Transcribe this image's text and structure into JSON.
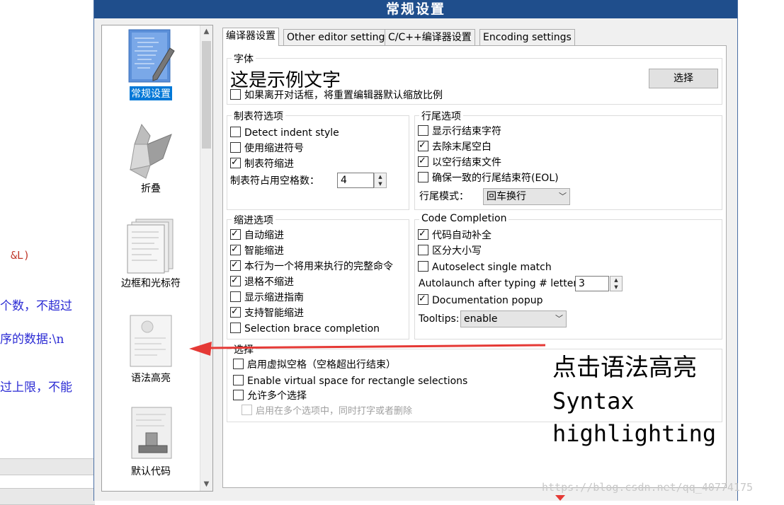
{
  "background": {
    "line1": "&L)",
    "line2": "个数，不超过",
    "line3": "序的数据:\\n",
    "line4": "过上限，不能"
  },
  "dialog": {
    "title": "常规设置"
  },
  "categories": [
    {
      "label": "常规设置",
      "icon": "editor-page-pencil-icon",
      "selected": true
    },
    {
      "label": "折叠",
      "icon": "origami-bird-icon",
      "selected": false
    },
    {
      "label": "边框和光标符",
      "icon": "document-stack-icon",
      "selected": false
    },
    {
      "label": "语法高亮",
      "icon": "highlight-page-icon",
      "selected": false
    },
    {
      "label": "默认代码",
      "icon": "stamp-page-icon",
      "selected": false
    }
  ],
  "tabs": [
    "编译器设置",
    "Other editor settings",
    "C/C++编译器设置",
    "Encoding settings"
  ],
  "font_group": {
    "title": "字体",
    "sample": "这是示例文字",
    "choose_button": "选择",
    "reset_zoom": {
      "label": "如果离开对话框，将重置编辑器默认缩放比例",
      "checked": false
    }
  },
  "tab_group": {
    "title": "制表符选项",
    "items": [
      {
        "label": "Detect indent style",
        "checked": false
      },
      {
        "label": "使用缩进符号",
        "checked": false
      },
      {
        "label": "制表符缩进",
        "checked": true
      }
    ],
    "spaces_label": "制表符占用空格数：",
    "spaces_value": "4"
  },
  "eol_group": {
    "title": "行尾选项",
    "items": [
      {
        "label": "显示行结束字符",
        "checked": false
      },
      {
        "label": "去除末尾空白",
        "checked": true
      },
      {
        "label": "以空行结束文件",
        "checked": true
      },
      {
        "label": "确保一致的行尾结束符(EOL)",
        "checked": false
      }
    ],
    "mode_label": "行尾模式：",
    "mode_value": "回车换行"
  },
  "indent_group": {
    "title": "缩进选项",
    "items": [
      {
        "label": "自动缩进",
        "checked": true
      },
      {
        "label": "智能缩进",
        "checked": true
      },
      {
        "label": "本行为一个将用来执行的完整命令",
        "checked": true
      },
      {
        "label": "退格不缩进",
        "checked": true
      },
      {
        "label": "显示缩进指南",
        "checked": false
      },
      {
        "label": "支持智能缩进",
        "checked": true
      },
      {
        "label": "Selection brace completion",
        "checked": false
      }
    ]
  },
  "completion_group": {
    "title": "Code Completion",
    "items": [
      {
        "label": "代码自动补全",
        "checked": true
      },
      {
        "label": "区分大小写",
        "checked": false
      },
      {
        "label": "Autoselect single match",
        "checked": false
      }
    ],
    "autolaunch_label": "Autolaunch after typing # letters:",
    "autolaunch_value": "3",
    "doc_popup": {
      "label": "Documentation popup",
      "checked": true
    },
    "tooltips_label": "Tooltips:",
    "tooltips_value": "enable"
  },
  "selection_group": {
    "title": "选择",
    "items": [
      {
        "label": "启用虚拟空格（空格超出行结束）",
        "checked": false
      },
      {
        "label": "Enable virtual space for rectangle selections",
        "checked": false
      },
      {
        "label": "允许多个选择",
        "checked": false
      },
      {
        "label": "启用在多个选项中，同时打字或者删除",
        "checked": false,
        "disabled": true
      }
    ]
  },
  "annotation": {
    "line1": "点击语法高亮",
    "line2": "Syntax",
    "line3": "highlighting",
    "arrow_color": "#e53935"
  },
  "watermark": "https://blog.csdn.net/qq_40774175"
}
